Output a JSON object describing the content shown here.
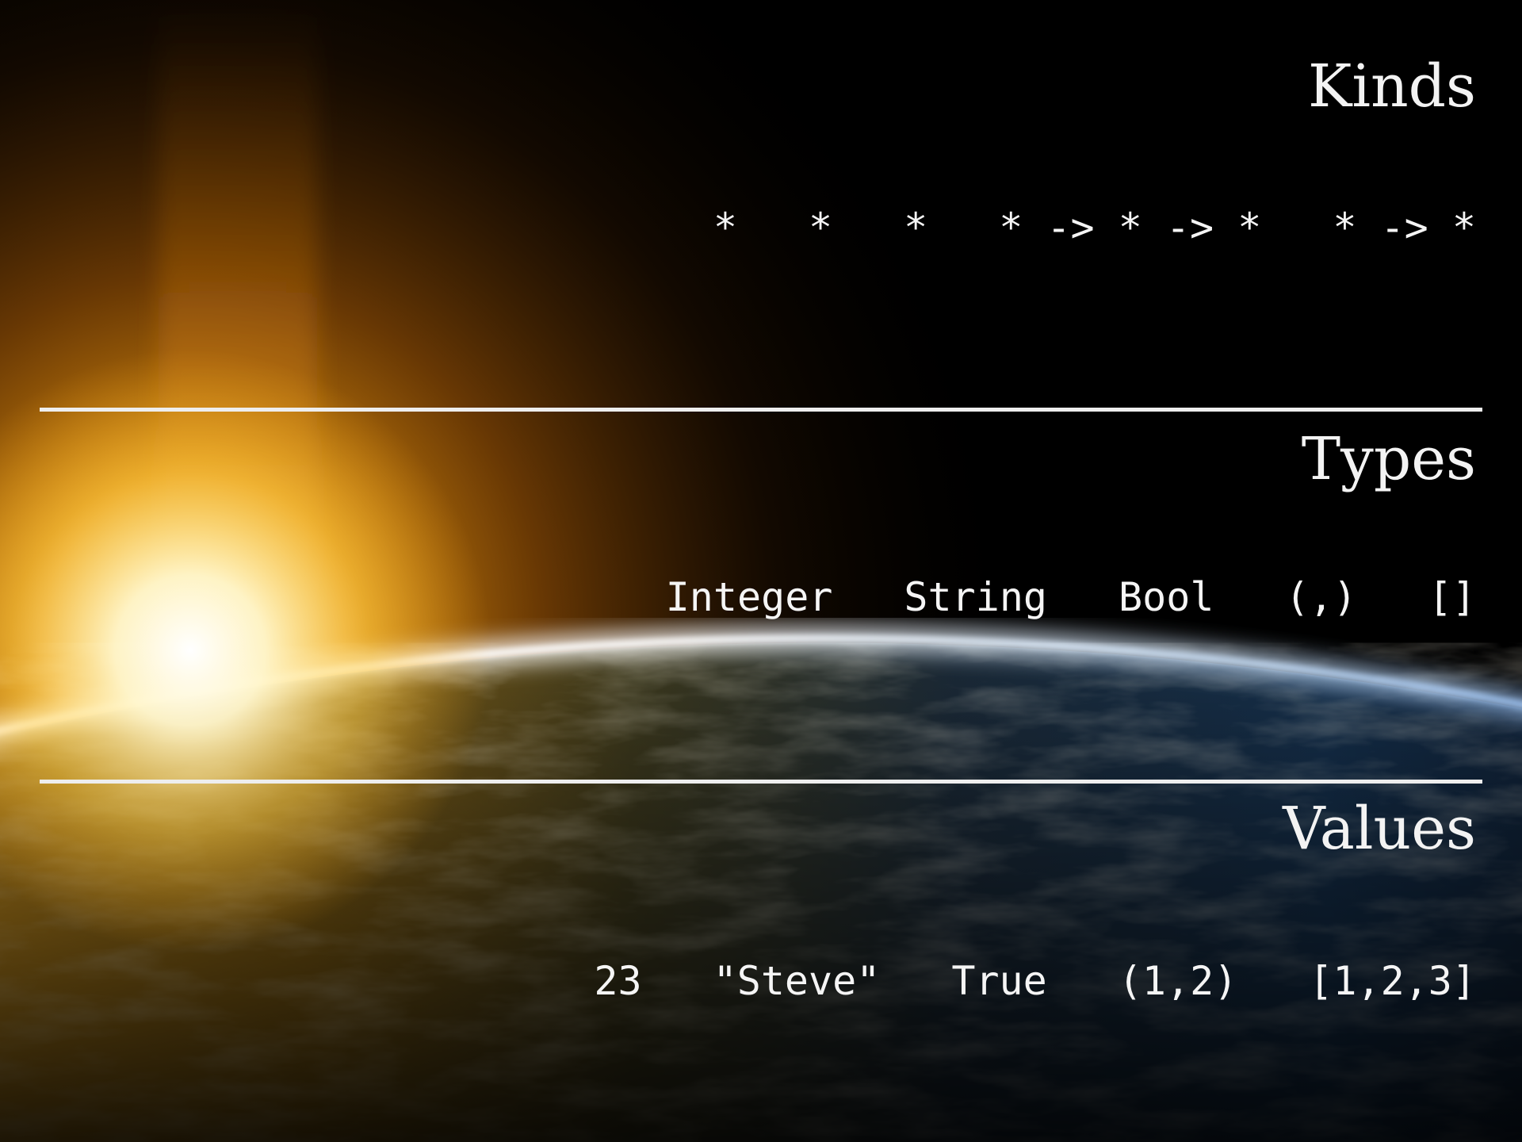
{
  "sections": [
    {
      "title": "Kinds",
      "items": [
        "*",
        "*",
        "*",
        "* -> * -> *",
        "* -> *"
      ]
    },
    {
      "title": "Types",
      "items": [
        "Integer",
        "String",
        "Bool",
        "(,)",
        "[]"
      ]
    },
    {
      "title": "Values",
      "items": [
        "23",
        "\"Steve\"",
        "True",
        "(1,2)",
        "[1,2,3]"
      ]
    }
  ]
}
